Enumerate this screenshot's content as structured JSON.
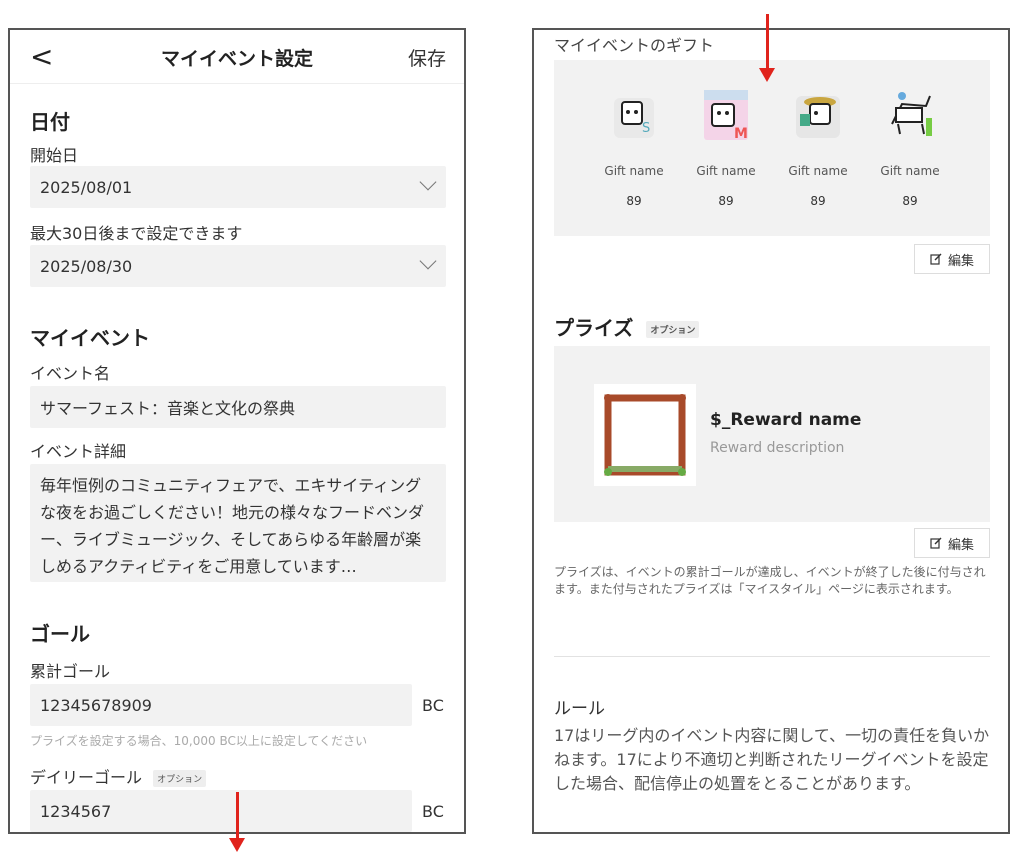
{
  "settings": {
    "title": "マイイベント設定",
    "save_label": "保存",
    "back_glyph": "<",
    "date_section": "日付",
    "start_label": "開始日",
    "start_value": "2025/08/01",
    "end_label": "最大30日後まで設定できます",
    "end_value": "2025/08/30",
    "my_event_section": "マイイベント",
    "event_name_label": "イベント名",
    "event_name_value": "サマーフェスト：音楽と文化の祭典",
    "event_detail_label": "イベント詳細",
    "event_detail_value": "毎年恒例のコミュニティフェアで、エキサイティングな夜をお過ごしください！地元の様々なフードベンダー、ライブミュージック、そしてあらゆる年齢層が楽しめるアクティビティをご用意しています…",
    "goal_section": "ゴール",
    "total_goal_label": "累計ゴール",
    "total_goal_value": "12345678909",
    "total_goal_unit": "BC",
    "total_goal_hint": "プライズを設定する場合、10,000 BC以上に設定してください",
    "daily_goal_label": "デイリーゴール",
    "daily_goal_badge": "オプション",
    "daily_goal_value": "1234567",
    "daily_goal_unit": "BC"
  },
  "gifts": {
    "section": "マイイベントのギフト",
    "items": [
      {
        "name": "Gift name",
        "price": "89"
      },
      {
        "name": "Gift name",
        "price": "89"
      },
      {
        "name": "Gift name",
        "price": "89"
      },
      {
        "name": "Gift name",
        "price": "89"
      }
    ],
    "edit_label": "編集"
  },
  "prize": {
    "section": "プライズ",
    "badge": "オプション",
    "reward_name": "$_Reward name",
    "reward_description": "Reward description",
    "edit_label": "編集",
    "note": "プライズは、イベントの累計ゴールが達成し、イベントが終了した後に付与されます。また付与されたプライズは「マイスタイル」ページに表示されます。"
  },
  "rules": {
    "section": "ルール",
    "text": "17はリーグ内のイベント内容に関して、一切の責任を負いかねます。17により不適切と判断されたリーグイベントを設定した場合、配信停止の処置をとることがあります。"
  },
  "colors": {
    "arrow": "#e0231c",
    "field_bg": "#f2f2f2"
  }
}
